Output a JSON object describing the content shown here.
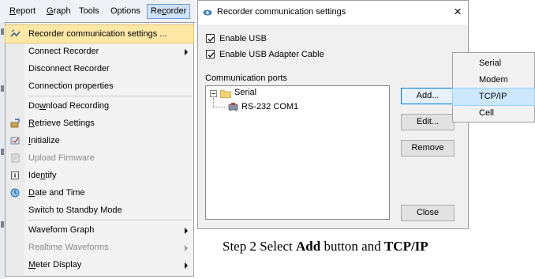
{
  "menubar": {
    "report": "Report",
    "graph": "Graph",
    "tools": "Tools",
    "options": "Options",
    "recorder": "Recorder"
  },
  "recorder_menu": {
    "items": [
      {
        "label": "Recorder communication settings ...",
        "state": "highlighted",
        "icon": "communication-settings-icon"
      },
      {
        "label": "Connect Recorder",
        "has_submenu": true
      },
      {
        "label": "Disconnect Recorder"
      },
      {
        "label": "Connection properties"
      },
      {
        "label": "Download Recording"
      },
      {
        "label": "Retrieve Settings",
        "icon": "retrieve-settings-icon"
      },
      {
        "label": "Initialize",
        "icon": "initialize-icon"
      },
      {
        "label": "Upload Firmware",
        "state": "disabled",
        "icon": "upload-firmware-icon"
      },
      {
        "label": "Identify",
        "icon": "identify-icon"
      },
      {
        "label": "Date and Time",
        "icon": "clock-icon"
      },
      {
        "label": "Switch to Standby Mode"
      },
      {
        "label": "Waveform Graph",
        "has_submenu": true
      },
      {
        "label": "Realtime Waveforms",
        "state": "disabled",
        "has_submenu": true
      },
      {
        "label": "Meter Display",
        "has_submenu": true
      }
    ]
  },
  "dialog": {
    "title": "Recorder communication settings",
    "close_glyph": "×",
    "enable_usb": {
      "label": "Enable USB",
      "checked": true
    },
    "enable_usb_adapter": {
      "label": "Enable USB Adapter Cable",
      "checked": true
    },
    "ports_label": "Communication ports",
    "tree": {
      "root": "Serial",
      "child": "RS-232 COM1"
    },
    "buttons": {
      "add": "Add...",
      "edit": "Edit...",
      "remove": "Remove",
      "close": "Close"
    }
  },
  "add_popup": {
    "items": [
      {
        "label": "Serial"
      },
      {
        "label": "Modem"
      },
      {
        "label": "TCP/IP",
        "state": "highlighted"
      },
      {
        "label": "Cell"
      }
    ]
  },
  "caption": {
    "prefix": "Step 2 Select ",
    "bold1": "Add",
    "middle": " button and ",
    "bold2": "TCP/IP"
  },
  "colors": {
    "menu_highlight": "#ffe8a6",
    "popup_highlight": "#cce8ff",
    "focus_border": "#0078d7"
  }
}
